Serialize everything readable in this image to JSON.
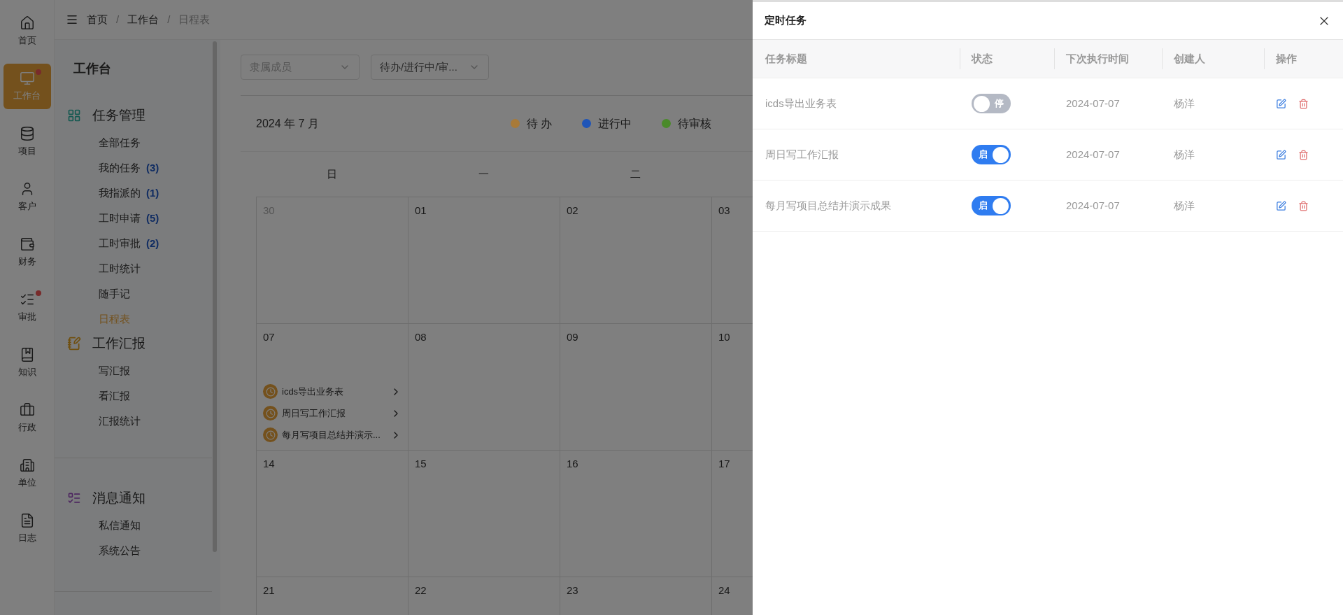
{
  "breadcrumb": [
    "首页",
    "工作台",
    "日程表"
  ],
  "breadcrumb_separator": "/",
  "nav": [
    {
      "label": "首页",
      "selected": false,
      "dot": false
    },
    {
      "label": "工作台",
      "selected": true,
      "dot": true
    },
    {
      "label": "项目",
      "selected": false,
      "dot": false
    },
    {
      "label": "客户",
      "selected": false,
      "dot": false
    },
    {
      "label": "财务",
      "selected": false,
      "dot": false
    },
    {
      "label": "审批",
      "selected": false,
      "dot": true
    },
    {
      "label": "知识",
      "selected": false,
      "dot": false
    },
    {
      "label": "行政",
      "selected": false,
      "dot": false
    },
    {
      "label": "单位",
      "selected": false,
      "dot": false
    },
    {
      "label": "日志",
      "selected": false,
      "dot": false
    }
  ],
  "sidebar": {
    "title": "工作台",
    "groups": [
      {
        "title": "任务管理",
        "items": [
          {
            "label": "全部任务",
            "selected": false
          },
          {
            "label": "我的任务",
            "count": "(3)",
            "selected": false
          },
          {
            "label": "我指派的",
            "count": "(1)",
            "selected": false
          },
          {
            "label": "工时申请",
            "count": "(5)",
            "selected": false
          },
          {
            "label": "工时审批",
            "count": "(2)",
            "selected": false
          },
          {
            "label": "工时统计",
            "selected": false
          },
          {
            "label": "随手记",
            "selected": false
          },
          {
            "label": "日程表",
            "selected": true
          }
        ]
      },
      {
        "title": "工作汇报",
        "items": [
          {
            "label": "写汇报",
            "selected": false
          },
          {
            "label": "看汇报",
            "selected": false
          },
          {
            "label": "汇报统计",
            "selected": false
          }
        ]
      },
      {
        "title": "消息通知",
        "items": [
          {
            "label": "私信通知",
            "selected": false
          },
          {
            "label": "系统公告",
            "selected": false
          }
        ]
      }
    ]
  },
  "filters": [
    {
      "placeholder": "隶属成员"
    },
    {
      "value": "待办/进行中/审..."
    }
  ],
  "calendar": {
    "month": "2024 年 7 月",
    "legend": [
      {
        "label": "待 办",
        "color": "#a87a38"
      },
      {
        "label": "进行中",
        "color": "#1f55b8"
      },
      {
        "label": "待审核",
        "color": "#4a8a2a"
      }
    ],
    "weekdays": [
      "日",
      "一",
      "二"
    ],
    "weeks": [
      [
        {
          "day": "30",
          "other_month": true
        },
        {
          "day": "01",
          "other_month": false
        },
        {
          "day": "02",
          "other_month": false
        },
        {
          "day": "03",
          "other_month": false
        }
      ],
      [
        {
          "day": "07",
          "other_month": false,
          "events": [
            "icds导出业务表",
            "周日写工作汇报",
            "每月写项目总结并演示..."
          ]
        },
        {
          "day": "08",
          "other_month": false
        },
        {
          "day": "09",
          "other_month": false
        },
        {
          "day": "10",
          "other_month": false
        }
      ],
      [
        {
          "day": "14",
          "other_month": false
        },
        {
          "day": "15",
          "other_month": false
        },
        {
          "day": "16",
          "other_month": false
        },
        {
          "day": "17",
          "other_month": false
        }
      ],
      [
        {
          "day": "21",
          "other_month": false
        },
        {
          "day": "22",
          "other_month": false
        },
        {
          "day": "23",
          "other_month": false
        },
        {
          "day": "24",
          "other_month": false
        }
      ]
    ]
  },
  "drawer": {
    "title": "定时任务",
    "columns": [
      "任务标题",
      "状态",
      "下次执行时间",
      "创建人",
      "操作"
    ],
    "rows": [
      {
        "title": "icds导出业务表",
        "on": false,
        "switch_text": "停",
        "next_run": "2024-07-07",
        "creator": "杨洋"
      },
      {
        "title": "周日写工作汇报",
        "on": true,
        "switch_text": "启",
        "next_run": "2024-07-07",
        "creator": "杨洋"
      },
      {
        "title": "每月写项目总结并演示成果",
        "on": true,
        "switch_text": "启",
        "next_run": "2024-07-07",
        "creator": "杨洋"
      }
    ]
  }
}
